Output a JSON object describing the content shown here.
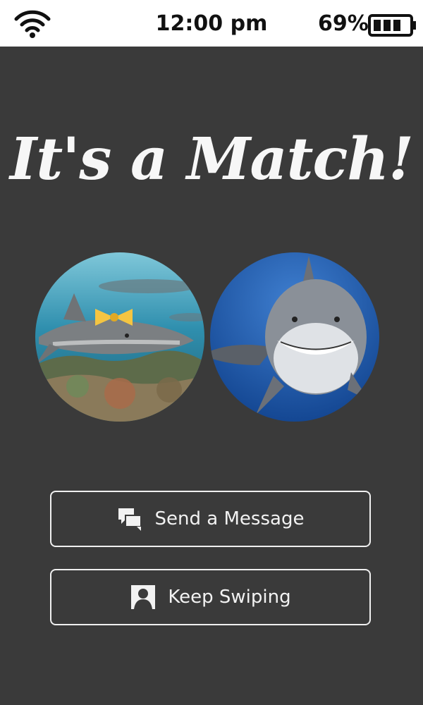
{
  "status_bar": {
    "time": "12:00 pm",
    "battery_percent": "69%",
    "battery_level": 0.69,
    "wifi_icon": "wifi-icon",
    "battery_icon": "battery-icon"
  },
  "match": {
    "title": "It's a Match!"
  },
  "photos": [
    {
      "name": "left-profile-photo",
      "description_icon": "shark-with-bowtie-photo"
    },
    {
      "name": "right-profile-photo",
      "description_icon": "great-white-shark-photo"
    }
  ],
  "buttons": {
    "send_message": {
      "label": "Send a Message",
      "icon": "chat-bubbles-icon"
    },
    "keep_swiping": {
      "label": "Keep Swiping",
      "icon": "person-silhouette-icon"
    }
  },
  "colors": {
    "background": "#3a3a3a",
    "status_bar": "#ffffff",
    "text": "#f2f2f2",
    "bowtie": "#f4c542",
    "ocean": "#1c52a8"
  }
}
